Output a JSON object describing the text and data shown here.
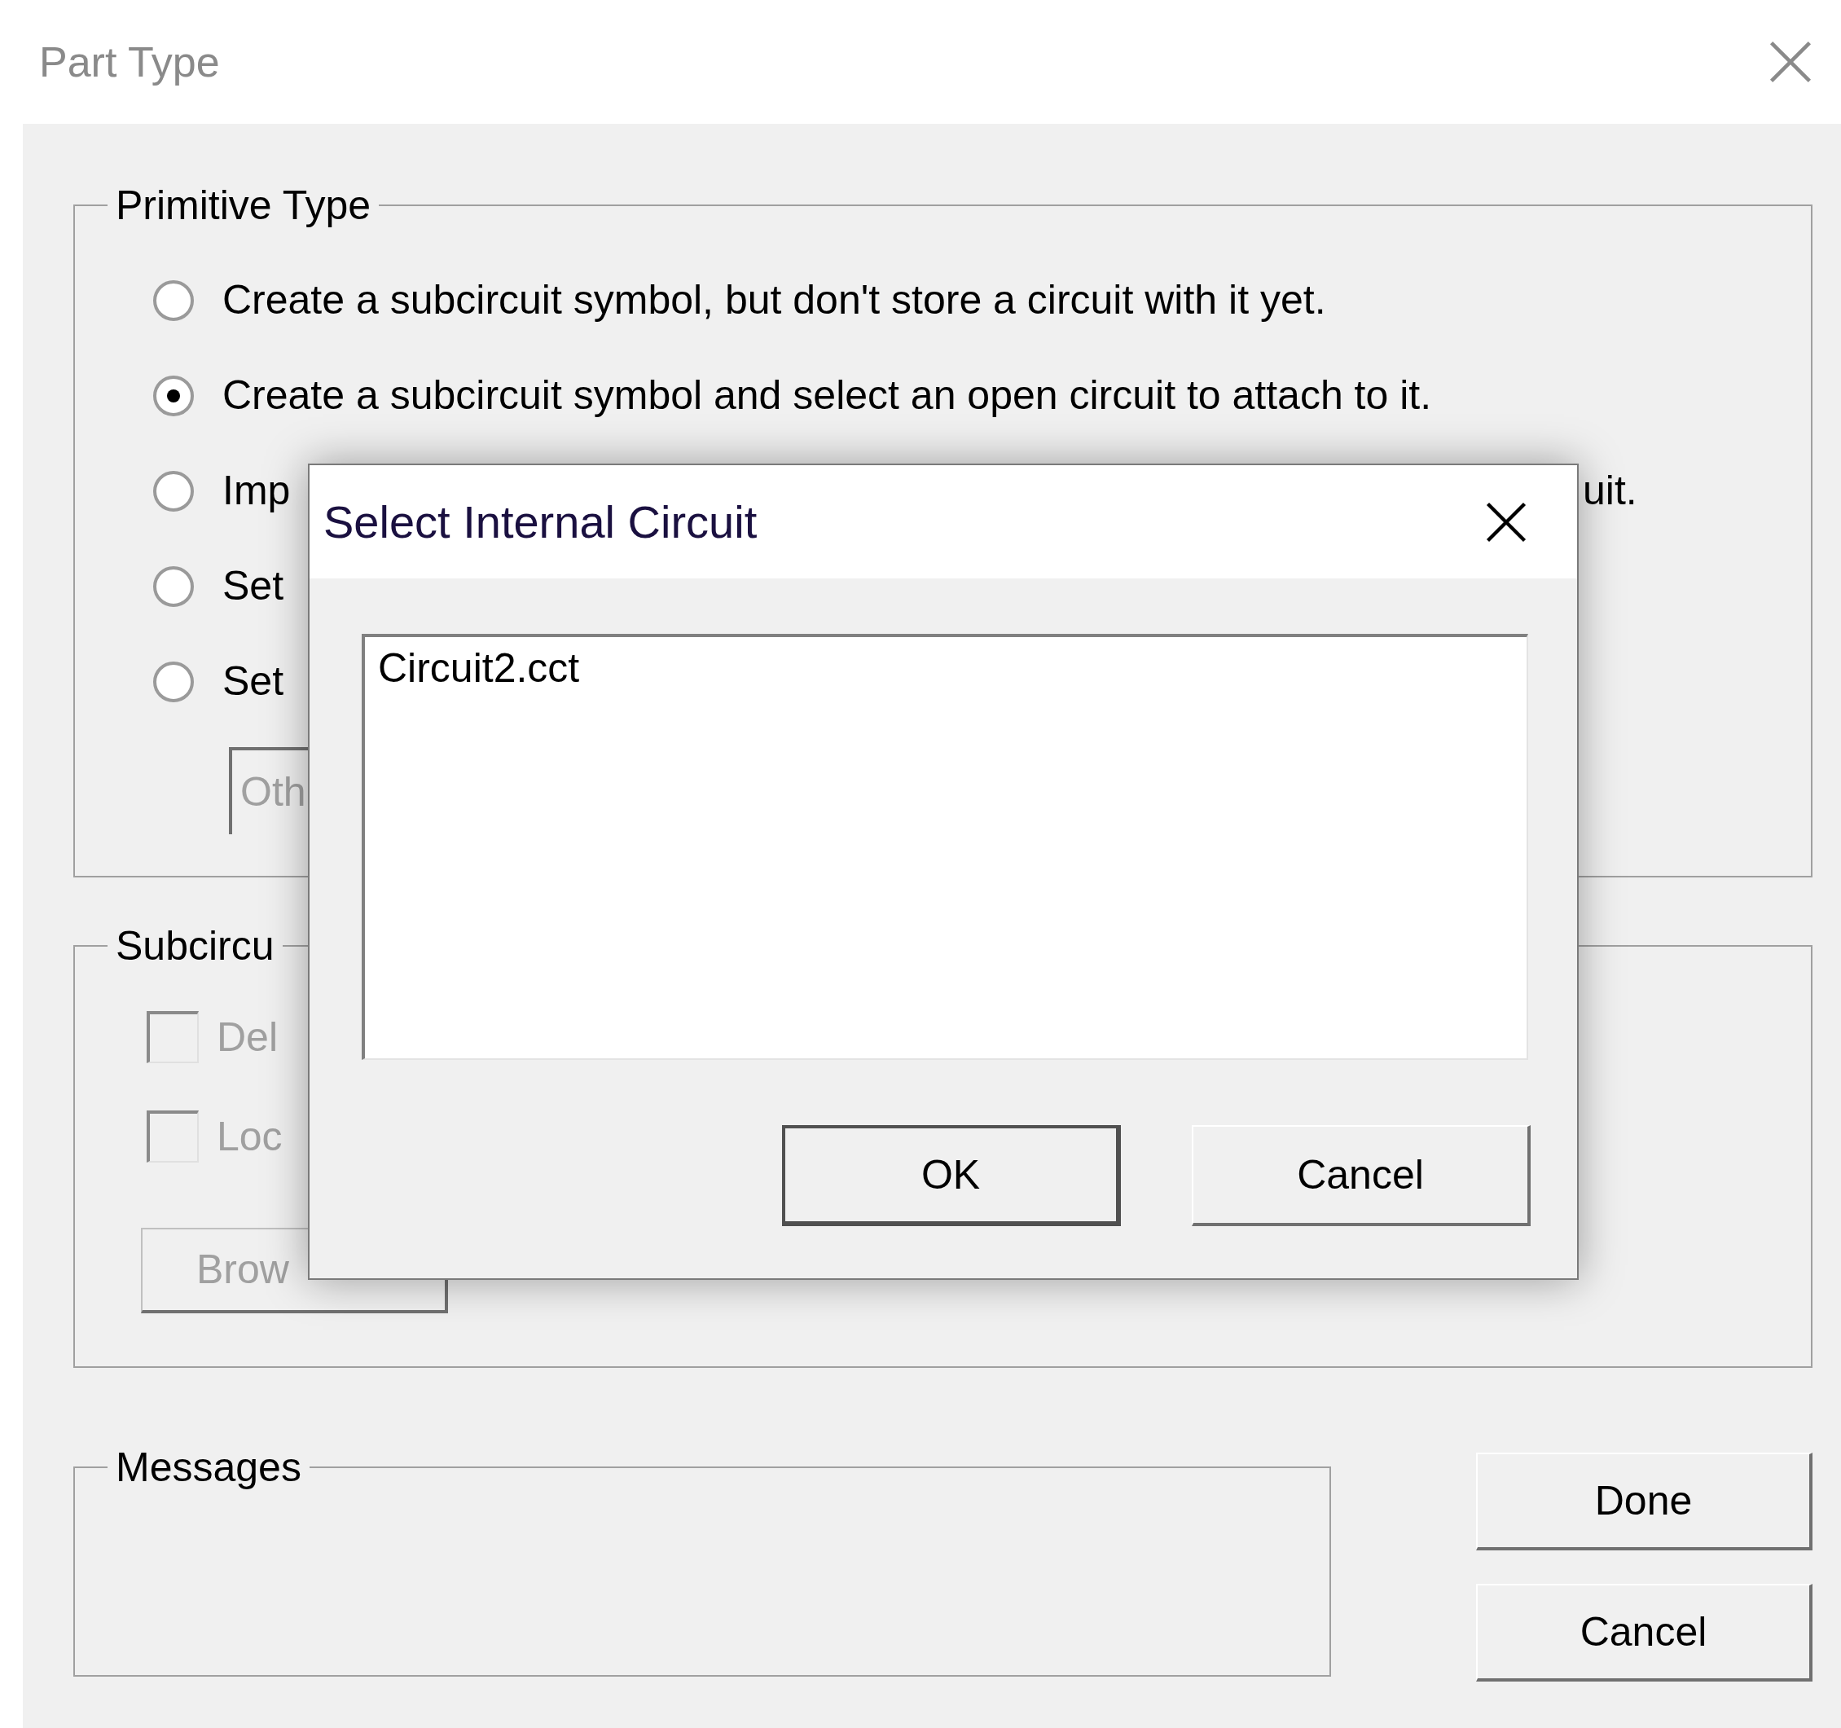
{
  "window": {
    "title": "Part Type"
  },
  "primitive_type": {
    "label": "Primitive Type",
    "options": [
      {
        "label": "Create a subcircuit symbol, but don't store a circuit with it yet.",
        "selected": false
      },
      {
        "label": "Create a subcircuit symbol and select an open circuit to attach to it.",
        "selected": true
      },
      {
        "label": "Imp",
        "label_end": "uit.",
        "selected": false
      },
      {
        "label": "Set",
        "selected": false
      },
      {
        "label": "Set",
        "selected": false
      }
    ],
    "button": {
      "label": "Oth",
      "disabled": true
    }
  },
  "subcircuit": {
    "label": "Subcircu",
    "checkboxes": [
      {
        "label": "Del",
        "checked": false,
        "disabled": true
      },
      {
        "label": "Loc",
        "checked": false,
        "disabled": true
      }
    ],
    "browse_button": {
      "label": "Brow",
      "disabled": true
    }
  },
  "messages": {
    "label": "Messages"
  },
  "buttons": [
    {
      "label": "Done"
    },
    {
      "label": "Cancel"
    }
  ],
  "dialog": {
    "title": "Select Internal Circuit",
    "list": [
      {
        "label": "Circuit2.cct",
        "selected": false
      }
    ],
    "buttons": [
      {
        "label": "OK",
        "default": true
      },
      {
        "label": "Cancel",
        "default": false
      }
    ]
  }
}
